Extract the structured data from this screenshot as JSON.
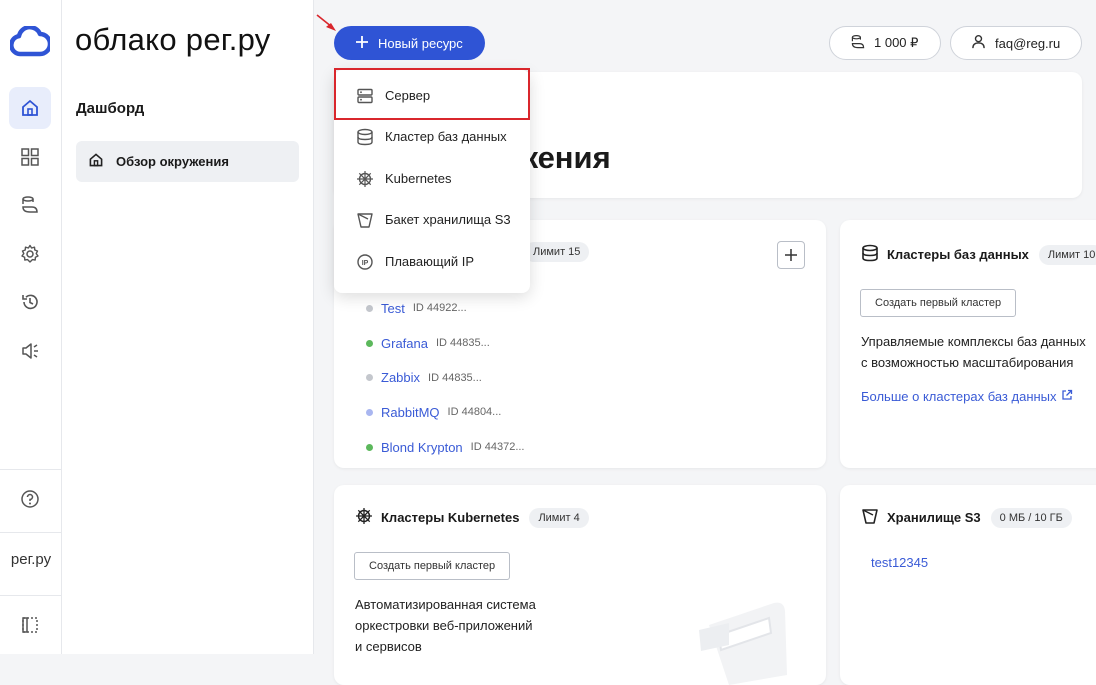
{
  "app": {
    "brand": "облако рег.ру",
    "rail_brand": "рег.ру"
  },
  "sidebar": {
    "section": "Дашборд",
    "nav_item": "Обзор окружения"
  },
  "topbar": {
    "new_resource": "Новый ресурс",
    "balance": "1 000 ₽",
    "user": "faq@reg.ru"
  },
  "dropdown": {
    "items": [
      {
        "label": "Сервер",
        "icon": "server-icon"
      },
      {
        "label": "Кластер баз данных",
        "icon": "database-icon"
      },
      {
        "label": "Kubernetes",
        "icon": "kubernetes-icon"
      },
      {
        "label": "Бакет хранилища S3",
        "icon": "bucket-icon"
      },
      {
        "label": "Плавающий IP",
        "icon": "ip-icon"
      }
    ]
  },
  "hero": {
    "title_visible": "жения"
  },
  "servers": {
    "limit": "Лимит 15",
    "items": [
      {
        "name": "Test",
        "id": "ID 44922...",
        "status_color": "#c4c7cd"
      },
      {
        "name": "Grafana",
        "id": "ID 44835...",
        "status_color": "#5cb85c"
      },
      {
        "name": "Zabbix",
        "id": "ID 44835...",
        "status_color": "#c4c7cd"
      },
      {
        "name": "RabbitMQ",
        "id": "ID 44804...",
        "status_color": "#a9b6f0"
      },
      {
        "name": "Blond Krypton",
        "id": "ID 44372...",
        "status_color": "#5cb85c"
      }
    ]
  },
  "db_clusters": {
    "title": "Кластеры баз данных",
    "limit": "Лимит 10",
    "button": "Создать первый кластер",
    "desc_line1": "Управляемые комплексы баз данных",
    "desc_line2": "с возможностью масштабирования",
    "link": "Больше о кластерах баз данных"
  },
  "k8s": {
    "title": "Кластеры Kubernetes",
    "limit": "Лимит 4",
    "button": "Создать первый кластер",
    "desc_line1": "Автоматизированная система",
    "desc_line2": "оркестровки веб-приложений",
    "desc_line3": "и сервисов"
  },
  "s3": {
    "title": "Хранилище S3",
    "usage": "0 МБ / 10 ГБ",
    "bucket": "test12345"
  },
  "colors": {
    "accent": "#2f54d5",
    "link": "#3a5bd6",
    "highlight": "#d9262c"
  }
}
